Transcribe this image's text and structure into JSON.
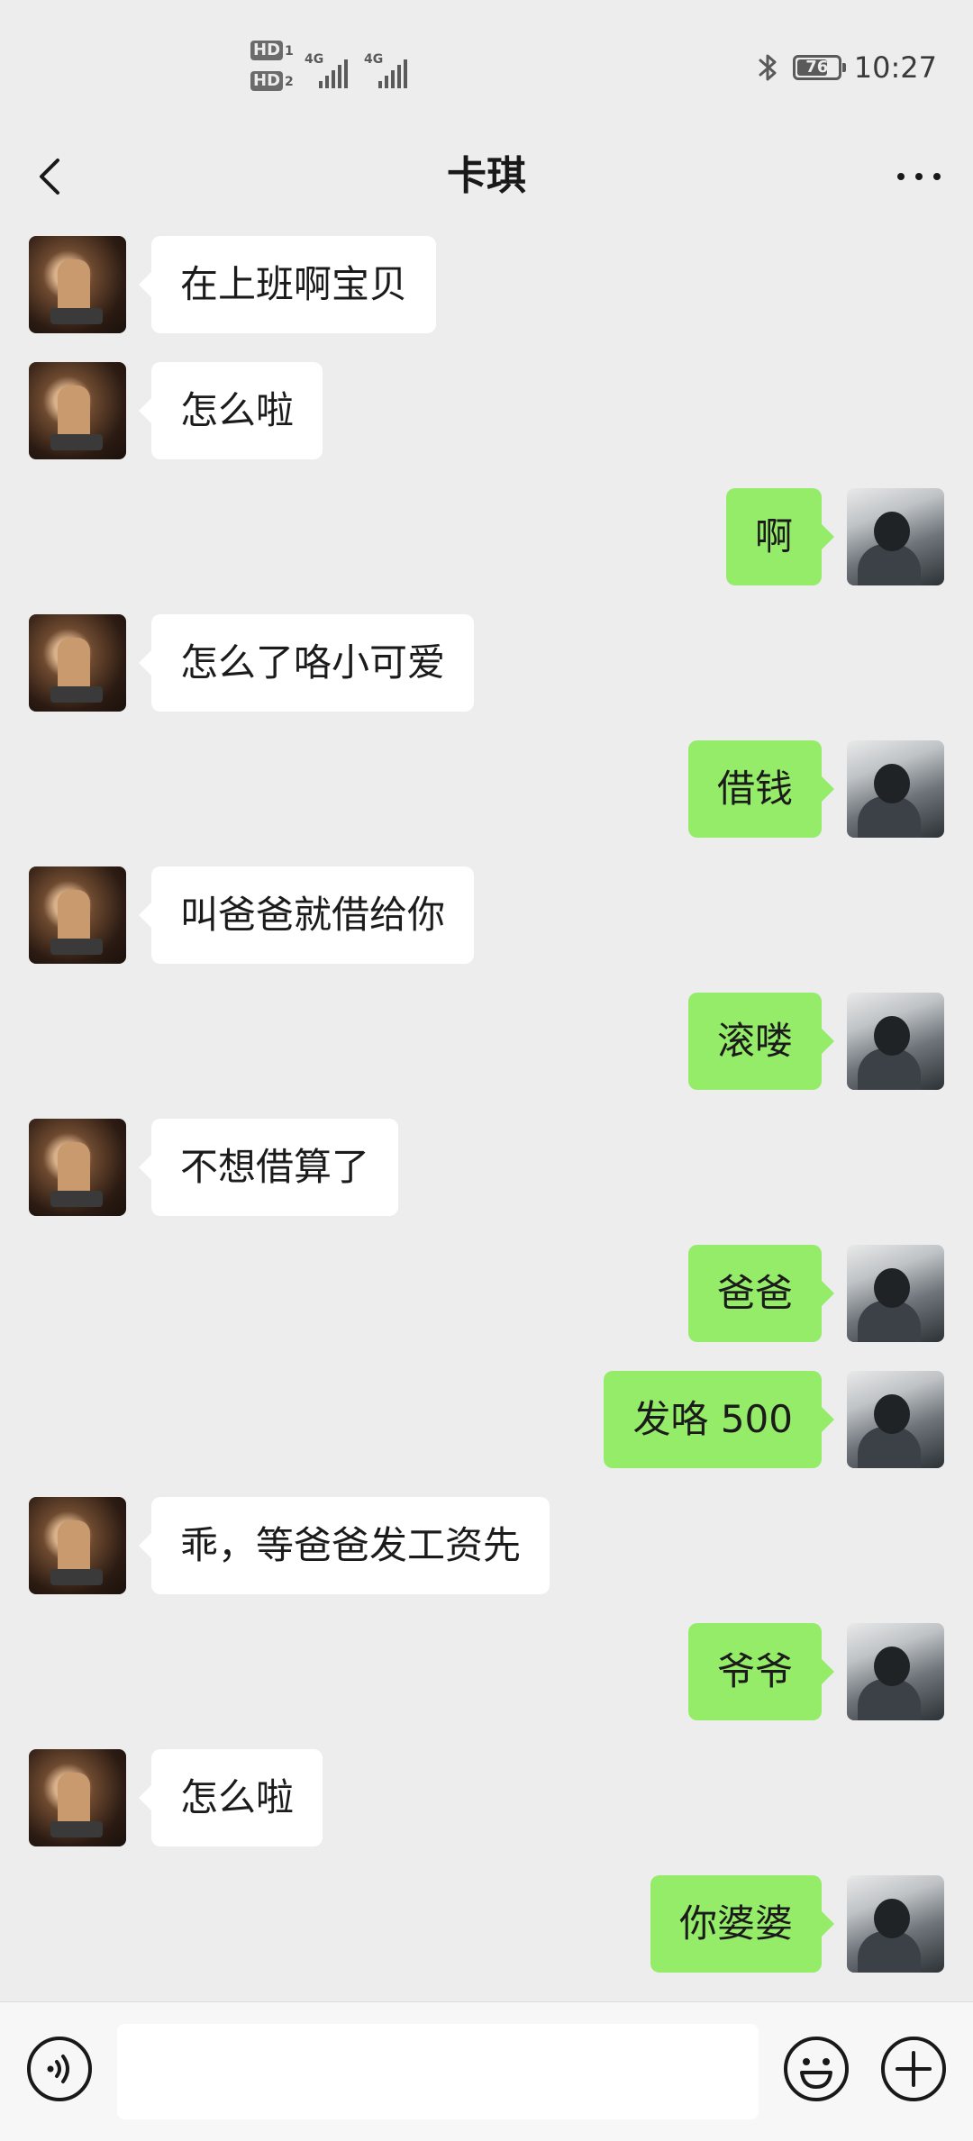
{
  "status_bar": {
    "hd1": "HD",
    "hd1_sub": "1",
    "hd2": "HD",
    "hd2_sub": "2",
    "network1": "4G",
    "network2": "4G",
    "battery": "76",
    "battery_level": 0.76,
    "time": "10:27",
    "bluetooth_icon": "bluetooth-icon"
  },
  "header": {
    "title": "卡琪",
    "back_icon": "chevron-left-icon",
    "more_icon": "more-horizontal-icon"
  },
  "messages": [
    {
      "side": "left",
      "text": "在上班啊宝贝"
    },
    {
      "side": "left",
      "text": "怎么啦"
    },
    {
      "side": "right",
      "text": "啊"
    },
    {
      "side": "left",
      "text": "怎么了咯小可爱"
    },
    {
      "side": "right",
      "text": "借钱"
    },
    {
      "side": "left",
      "text": "叫爸爸就借给你"
    },
    {
      "side": "right",
      "text": "滚喽"
    },
    {
      "side": "left",
      "text": "不想借算了"
    },
    {
      "side": "right",
      "text": "爸爸"
    },
    {
      "side": "right",
      "text": "发咯 500"
    },
    {
      "side": "left",
      "text": "乖，等爸爸发工资先"
    },
    {
      "side": "right",
      "text": "爷爷"
    },
    {
      "side": "left",
      "text": "怎么啦"
    },
    {
      "side": "right",
      "text": "你婆婆"
    }
  ],
  "input_bar": {
    "value": "",
    "placeholder": "",
    "voice_icon": "voice-icon",
    "emoji_icon": "emoji-icon",
    "plus_icon": "plus-icon"
  },
  "colors": {
    "background": "#ededed",
    "bubble_self": "#95ec69",
    "bubble_other": "#ffffff",
    "text": "#1b1b1b"
  }
}
